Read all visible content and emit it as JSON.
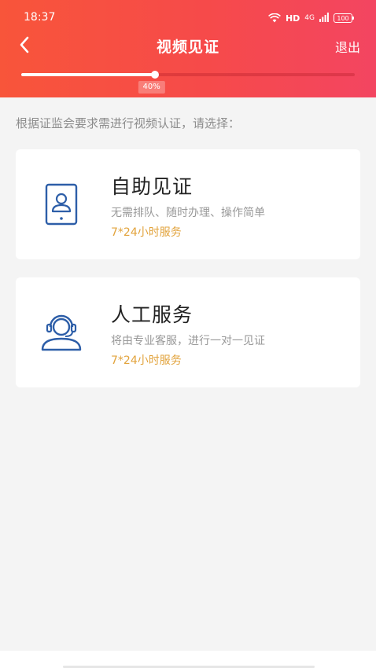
{
  "status_bar": {
    "time": "18:37",
    "hd": "HD",
    "signal": "4G",
    "battery": "100",
    "icons": [
      "wifi-icon",
      "signal-icon",
      "battery-icon"
    ]
  },
  "header": {
    "title": "视频见证",
    "back_icon": "chevron-left-icon",
    "exit_label": "退出",
    "progress_percent": 40,
    "progress_label": "40%"
  },
  "instruction": "根据证监会要求需进行视频认证，请选择：",
  "options": [
    {
      "title": "自助见证",
      "description": "无需排队、随时办理、操作简单",
      "service": "7*24小时服务",
      "icon": "tablet-user-icon"
    },
    {
      "title": "人工服务",
      "description": "将由专业客服，进行一对一见证",
      "service": "7*24小时服务",
      "icon": "headset-agent-icon"
    }
  ],
  "colors": {
    "header_gradient_start": "#f8553a",
    "header_gradient_end": "#f34561",
    "service_text": "#e2a33c",
    "icon_blue": "#2d5ea8"
  }
}
